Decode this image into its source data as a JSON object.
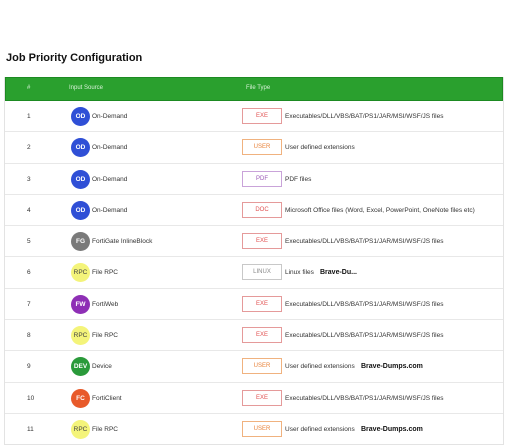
{
  "page": {
    "title": "Job Priority Configuration"
  },
  "table": {
    "headers": {
      "num": "#",
      "source": "Input Source",
      "filetype": "File Type"
    },
    "rows": [
      {
        "num": "1",
        "badge": "OD",
        "badge_color": "#2f4fd6",
        "source": "On-Demand",
        "ft": "EXE",
        "ft_kind": "exe",
        "desc": "Executables/DLL/VBS/BAT/PS1/JAR/MSI/WSF/JS files",
        "wm": ""
      },
      {
        "num": "2",
        "badge": "OD",
        "badge_color": "#2f4fd6",
        "source": "On-Demand",
        "ft": "USER",
        "ft_kind": "user",
        "desc": "User defined extensions",
        "wm": ""
      },
      {
        "num": "3",
        "badge": "OD",
        "badge_color": "#2f4fd6",
        "source": "On-Demand",
        "ft": "PDF",
        "ft_kind": "pdf",
        "desc": "PDF files",
        "wm": ""
      },
      {
        "num": "4",
        "badge": "OD",
        "badge_color": "#2f4fd6",
        "source": "On-Demand",
        "ft": "DOC",
        "ft_kind": "doc",
        "desc": "Microsoft Office files (Word, Excel, PowerPoint, OneNote files etc)",
        "wm": ""
      },
      {
        "num": "5",
        "badge": "FG",
        "badge_color": "#7a7a7a",
        "source": "FortiGate InlineBlock",
        "ft": "EXE",
        "ft_kind": "exe",
        "desc": "Executables/DLL/VBS/BAT/PS1/JAR/MSI/WSF/JS files",
        "wm": ""
      },
      {
        "num": "6",
        "badge": "RPC",
        "badge_color": "#f4f47a",
        "source": "File RPC",
        "ft": "LINUX",
        "ft_kind": "linux",
        "desc": "Linux files",
        "wm": "Brave-Du..."
      },
      {
        "num": "7",
        "badge": "FW",
        "badge_color": "#8e2fb5",
        "source": "FortiWeb",
        "ft": "EXE",
        "ft_kind": "exe",
        "desc": "Executables/DLL/VBS/BAT/PS1/JAR/MSI/WSF/JS files",
        "wm": ""
      },
      {
        "num": "8",
        "badge": "RPC",
        "badge_color": "#f4f47a",
        "source": "File RPC",
        "ft": "EXE",
        "ft_kind": "exe",
        "desc": "Executables/DLL/VBS/BAT/PS1/JAR/MSI/WSF/JS files",
        "wm": ""
      },
      {
        "num": "9",
        "badge": "DEV",
        "badge_color": "#2a9a3a",
        "source": "Device",
        "ft": "USER",
        "ft_kind": "user",
        "desc": "User defined extensions",
        "wm": "Brave-Dumps.com"
      },
      {
        "num": "10",
        "badge": "FC",
        "badge_color": "#e85a2a",
        "source": "FortiClient",
        "ft": "EXE",
        "ft_kind": "exe",
        "desc": "Executables/DLL/VBS/BAT/PS1/JAR/MSI/WSF/JS files",
        "wm": ""
      },
      {
        "num": "11",
        "badge": "RPC",
        "badge_color": "#f4f47a",
        "source": "File RPC",
        "ft": "USER",
        "ft_kind": "user",
        "desc": "User defined extensions",
        "wm": "Brave-Dumps.com"
      }
    ]
  }
}
